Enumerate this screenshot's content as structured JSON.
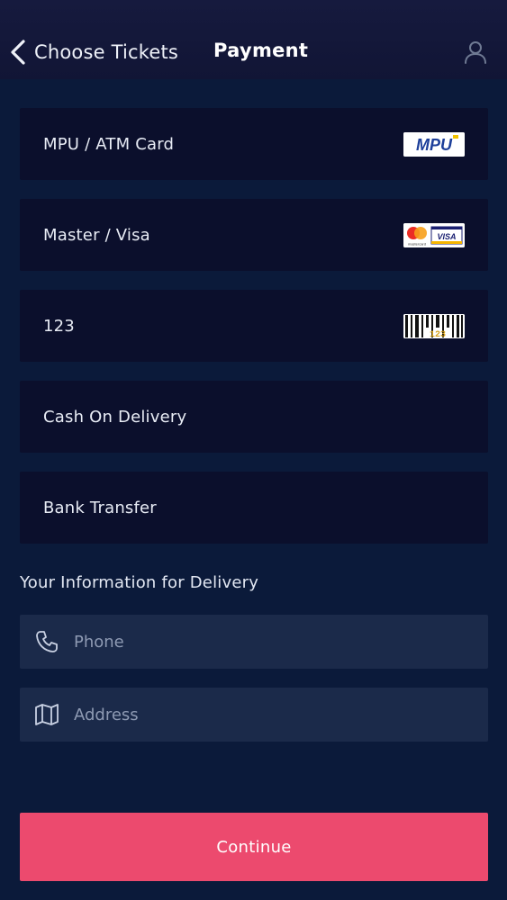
{
  "header": {
    "back_label": "Choose Tickets",
    "title": "Payment",
    "user_icon": "user-icon",
    "back_icon": "chevron-left-icon"
  },
  "payment_methods": [
    {
      "label": "MPU / ATM Card",
      "logo": "mpu-logo",
      "logo_text": "MPU"
    },
    {
      "label": "Master / Visa",
      "logo": "mastercard-visa-logo",
      "logo_text": "VISA",
      "logo_subtext": "mastercard"
    },
    {
      "label": "123",
      "logo": "123-barcode-logo",
      "logo_text": "123"
    },
    {
      "label": "Cash On Delivery"
    },
    {
      "label": "Bank Transfer"
    }
  ],
  "delivery": {
    "section_title": "Your Information for Delivery",
    "phone": {
      "placeholder": "Phone",
      "value": "",
      "icon": "phone-icon"
    },
    "address": {
      "placeholder": "Address",
      "value": "",
      "icon": "map-icon"
    }
  },
  "continue_label": "Continue",
  "colors": {
    "background": "#0b1a3a",
    "header": "#161a3e",
    "option_card": "#0b0f2c",
    "input_field": "#1b2a4a",
    "accent": "#ec4a6e",
    "placeholder": "#8e9ab3"
  }
}
